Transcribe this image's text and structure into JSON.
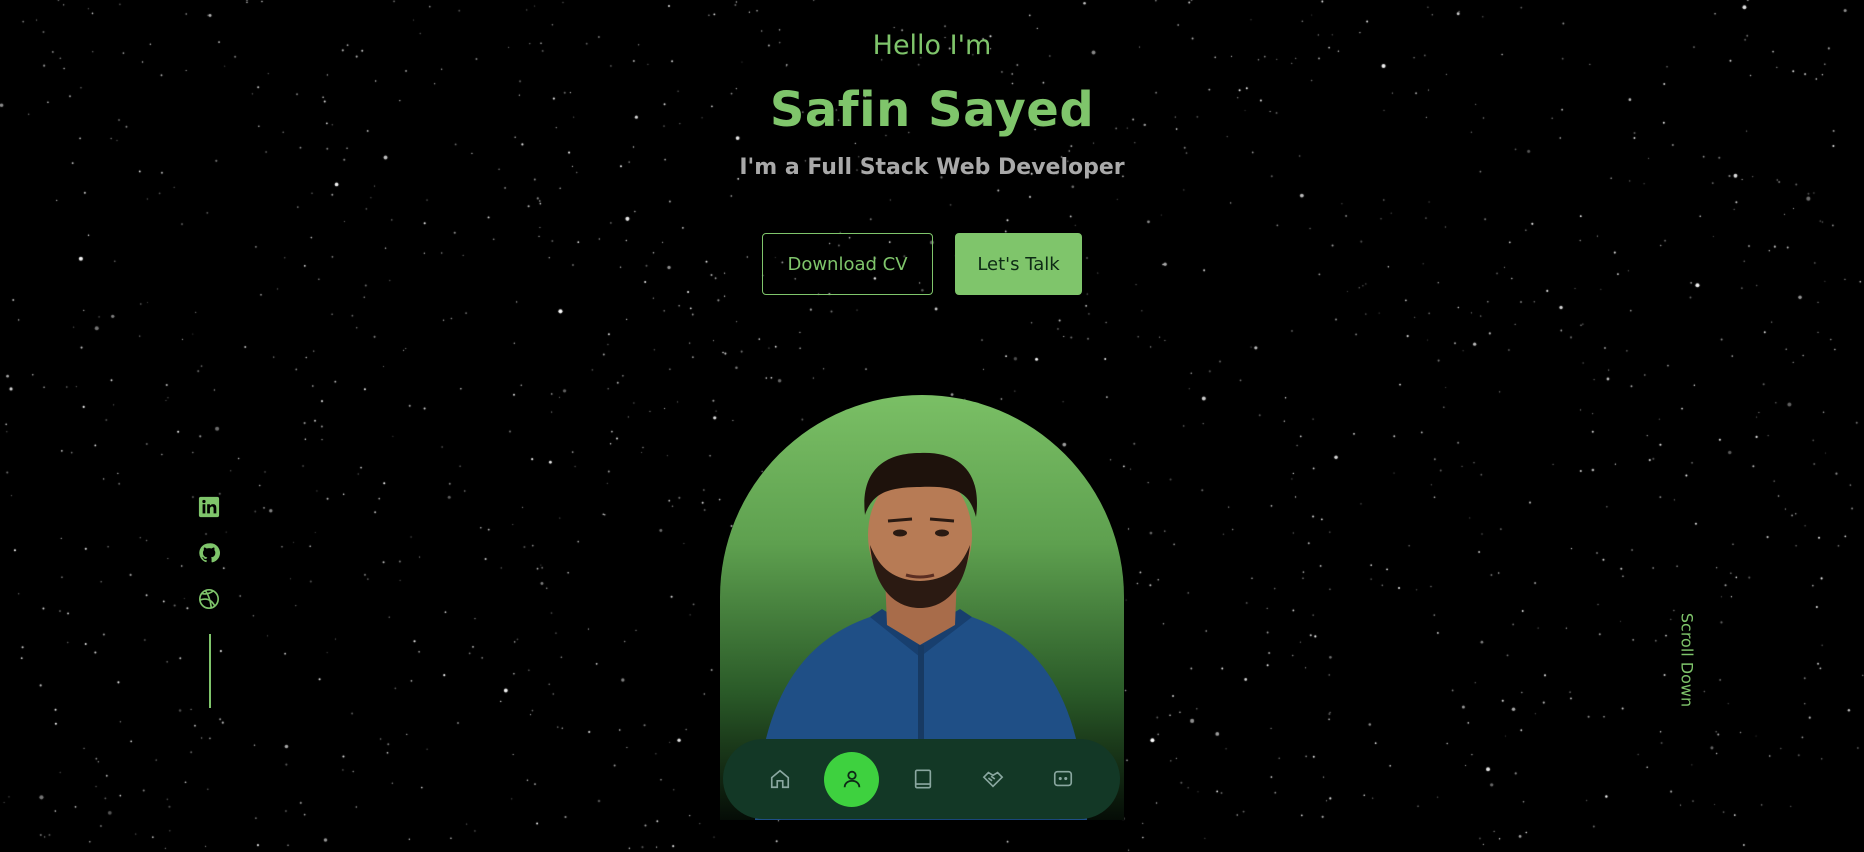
{
  "hero": {
    "greeting": "Hello I'm",
    "name": "Safin Sayed",
    "role": "I'm a Full Stack Web Developer",
    "download_cv_label": "Download CV",
    "lets_talk_label": "Let's Talk"
  },
  "social": {
    "icons": [
      "linkedin-icon",
      "github-icon",
      "dribbble-icon"
    ]
  },
  "scroll": {
    "label": "Scroll Down"
  },
  "nav": {
    "items": [
      "home-icon",
      "user-icon",
      "book-icon",
      "handshake-icon",
      "chat-icon"
    ],
    "active": "user-icon"
  },
  "colors": {
    "accent": "#7fc56b",
    "active_nav": "#3ed13f",
    "nav_bg": "#133826",
    "role_text": "#a9a9a9",
    "background": "#000000"
  }
}
